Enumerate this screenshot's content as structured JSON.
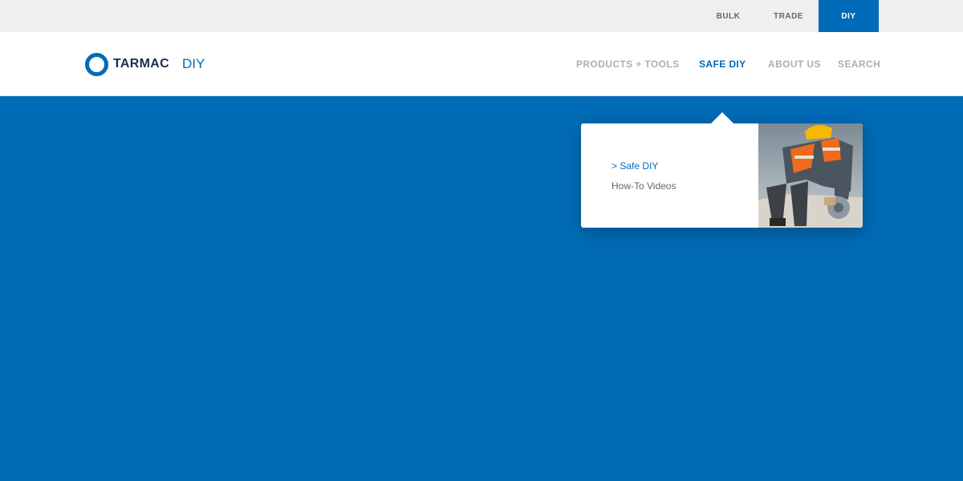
{
  "audience_tabs": {
    "bulk": "BULK",
    "trade": "TRADE",
    "diy": "DIY"
  },
  "header": {
    "logo_word": "TARMAC",
    "logo_sub": "DIY",
    "nav": {
      "products": "PRODUCTS + TOOLS",
      "safe_diy": "SAFE DIY",
      "about": "ABOUT US",
      "search": "SEARCH"
    }
  },
  "dropdown": {
    "items": [
      "> Safe DIY",
      "How-To Videos"
    ]
  },
  "colors": {
    "brand_blue": "#006bb6",
    "navy": "#1b2d4f",
    "nav_grey": "#aab0b6",
    "topbar_bg": "#efefef"
  },
  "icons": {
    "logo": "tarmac-ring-logo-icon"
  }
}
